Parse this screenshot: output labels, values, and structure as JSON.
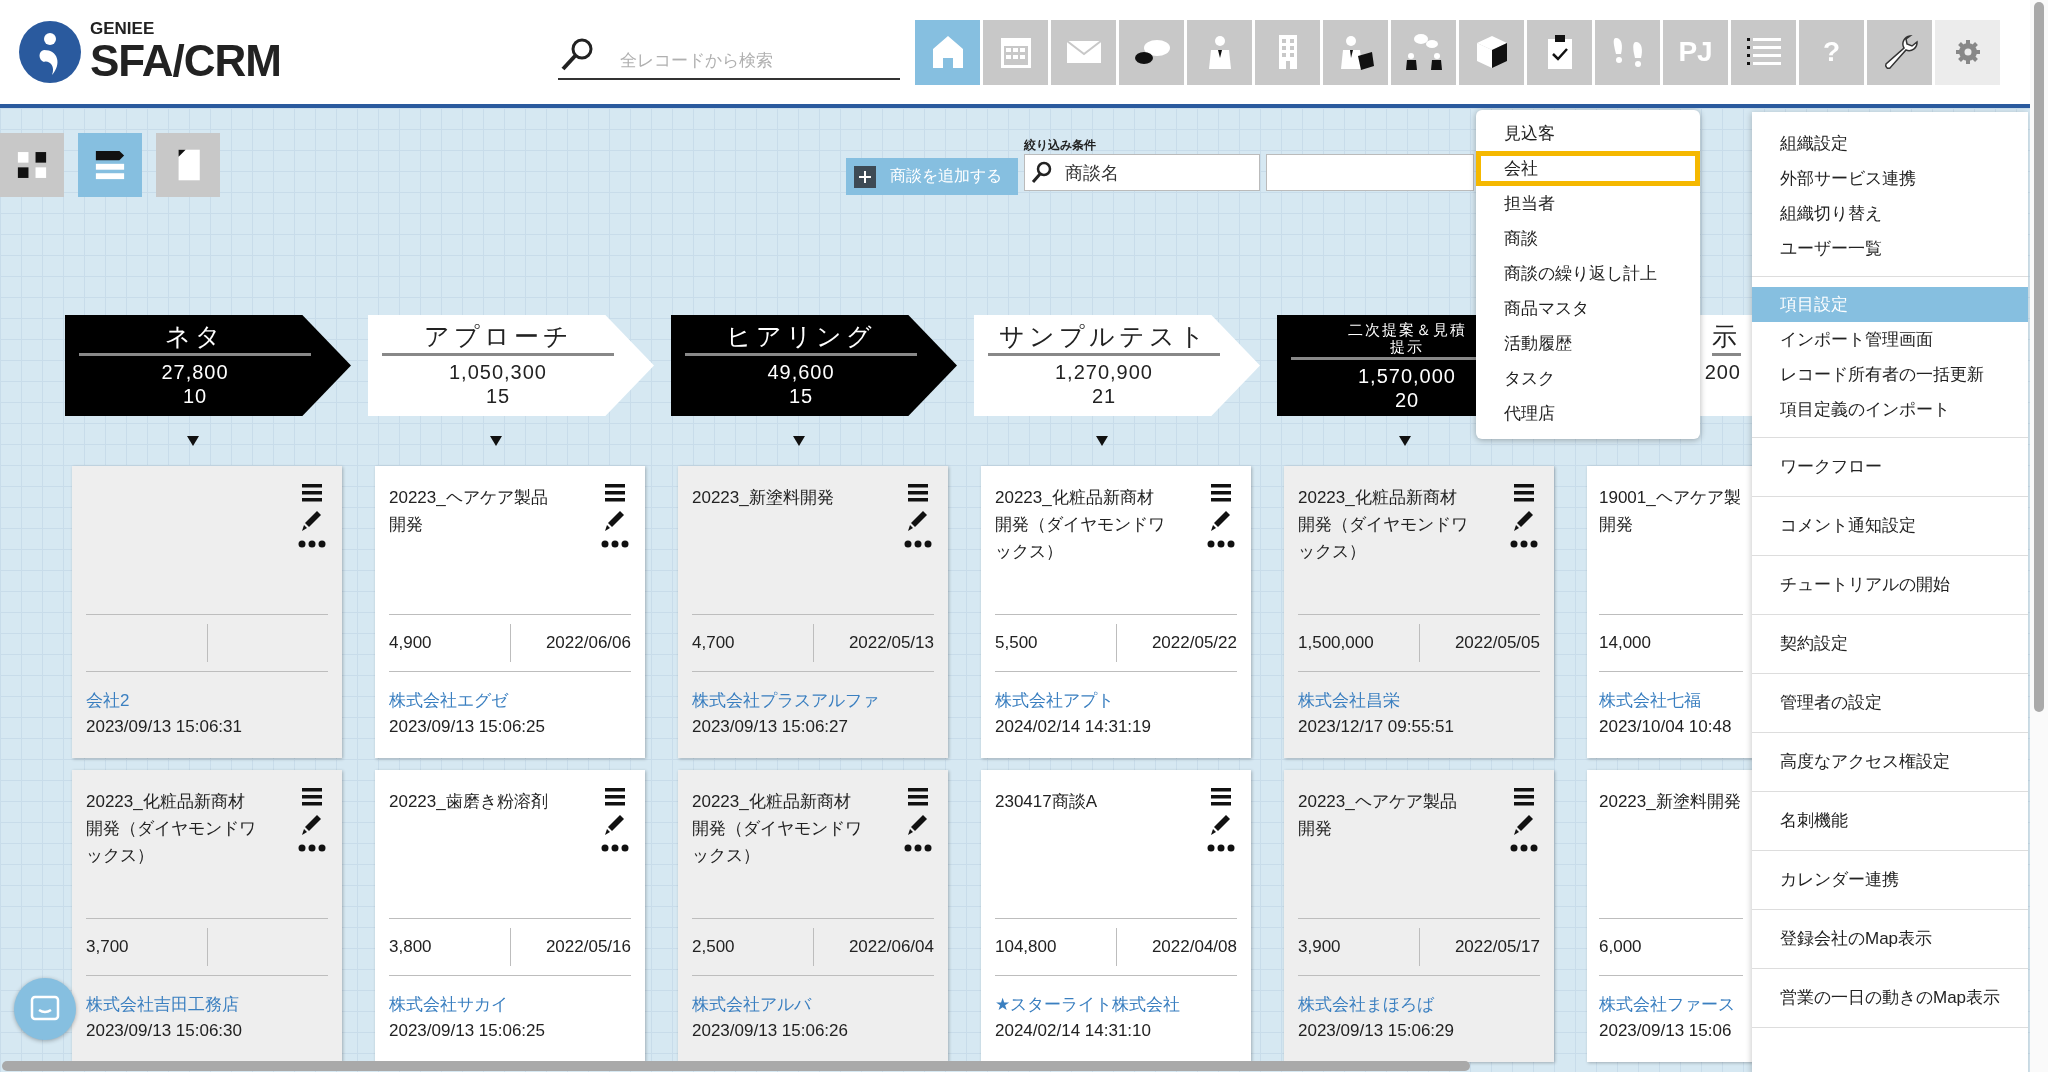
{
  "header": {
    "logo_small": "GENIEE",
    "logo_large": "SFA/CRM",
    "search": {
      "placeholder": "全レコードから検索"
    },
    "nav": [
      {
        "selected": true,
        "open": false
      },
      {
        "selected": false,
        "open": false
      },
      {
        "selected": false,
        "open": false
      },
      {
        "selected": false,
        "open": false
      },
      {
        "selected": false,
        "open": false
      },
      {
        "selected": false,
        "open": false
      },
      {
        "selected": false,
        "open": false
      },
      {
        "selected": false,
        "open": false
      },
      {
        "selected": false,
        "open": false
      },
      {
        "selected": false,
        "open": false
      },
      {
        "selected": false,
        "open": false
      },
      {
        "selected": false,
        "open": false,
        "label": "PJ"
      },
      {
        "selected": false,
        "open": false
      },
      {
        "selected": false,
        "open": false,
        "label": "?"
      },
      {
        "selected": false,
        "open": false
      },
      {
        "selected": false,
        "open": true
      }
    ]
  },
  "views": [
    {
      "selected": false
    },
    {
      "selected": true
    },
    {
      "selected": false
    }
  ],
  "add_button": {
    "label": "商談を追加する"
  },
  "filter": {
    "label": "絞り込み条件",
    "field": {
      "value": "商談名"
    }
  },
  "stages": [
    {
      "title": "ネタ",
      "amount": "27,800",
      "count": "10",
      "dark": true,
      "cards": [
        {
          "company": "会社2",
          "datetime": "2023/09/13 15:06:31"
        },
        {
          "title": "20223_化粧品新商材開発（ダイヤモンドワックス）",
          "amount": "3,700",
          "company": "株式会社吉田工務店",
          "datetime": "2023/09/13 15:06:30"
        }
      ]
    },
    {
      "title": "アプローチ",
      "amount": "1,050,300",
      "count": "15",
      "dark": false,
      "cards": [
        {
          "title": "20223_ヘアケア製品開発",
          "amount": "4,900",
          "date": "2022/06/06",
          "company": "株式会社エグゼ",
          "datetime": "2023/09/13 15:06:25"
        },
        {
          "title": "20223_歯磨き粉溶剤",
          "amount": "3,800",
          "date": "2022/05/16",
          "company": "株式会社サカイ",
          "datetime": "2023/09/13 15:06:25"
        }
      ]
    },
    {
      "title": "ヒアリング",
      "amount": "49,600",
      "count": "15",
      "dark": true,
      "cards": [
        {
          "title": "20223_新塗料開発",
          "amount": "4,700",
          "date": "2022/05/13",
          "company": "株式会社プラスアルファ",
          "datetime": "2023/09/13 15:06:27"
        },
        {
          "title": "20223_化粧品新商材開発（ダイヤモンドワックス）",
          "amount": "2,500",
          "date": "2022/06/04",
          "company": "株式会社アルバ",
          "datetime": "2023/09/13 15:06:26"
        }
      ]
    },
    {
      "title": "サンプルテスト",
      "amount": "1,270,900",
      "count": "21",
      "dark": false,
      "cards": [
        {
          "title": "20223_化粧品新商材開発（ダイヤモンドワックス）",
          "amount": "5,500",
          "date": "2022/05/22",
          "company": "株式会社アプト",
          "datetime": "2024/02/14 14:31:19"
        },
        {
          "title": "230417商談A",
          "amount": "104,800",
          "date": "2022/04/08",
          "company": "★スターライト株式会社",
          "datetime": "2024/02/14 14:31:10"
        }
      ]
    },
    {
      "title": "二次提案＆見積提示",
      "amount": "1,570,000",
      "count": "20",
      "dark": true,
      "cards": [
        {
          "title": "20223_化粧品新商材開発（ダイヤモンドワックス）",
          "amount": "1,500,000",
          "date": "2022/05/05",
          "company": "株式会社昌栄",
          "datetime": "2023/12/17 09:55:51"
        },
        {
          "title": "20223_ヘアケア製品開発",
          "amount": "3,900",
          "date": "2022/05/17",
          "company": "株式会社まほろば",
          "datetime": "2023/09/13 15:06:29"
        }
      ]
    },
    {
      "title": "示",
      "amount": "200",
      "dark": false,
      "cards": [
        {
          "title": "19001_ヘアケア製開発",
          "amount": "14,000",
          "company": "株式会社七福",
          "datetime": "2023/10/04 10:48"
        },
        {
          "title": "20223_新塗料開発",
          "amount": "6,000",
          "company": "株式会社ファース",
          "datetime": "2023/09/13 15:06"
        }
      ]
    }
  ],
  "record_menu": {
    "items": [
      {
        "label": "見込客",
        "selected": false
      },
      {
        "label": "会社",
        "selected": true
      },
      {
        "label": "担当者",
        "selected": false
      },
      {
        "label": "商談",
        "selected": false
      },
      {
        "label": "商談の繰り返し計上",
        "selected": false
      },
      {
        "label": "商品マスタ",
        "selected": false
      },
      {
        "label": "活動履歴",
        "selected": false
      },
      {
        "label": "タスク",
        "selected": false
      },
      {
        "label": "代理店",
        "selected": false
      }
    ]
  },
  "settings_menu": {
    "groups": [
      {
        "items": [
          {
            "label": "組織設定",
            "selected": false
          },
          {
            "label": "外部サービス連携",
            "selected": false
          },
          {
            "label": "組織切り替え",
            "selected": false
          },
          {
            "label": "ユーザー一覧",
            "selected": false
          }
        ]
      },
      {
        "items": [
          {
            "label": "項目設定",
            "selected": true
          },
          {
            "label": "インポート管理画面",
            "selected": false
          },
          {
            "label": "レコード所有者の一括更新",
            "selected": false
          },
          {
            "label": "項目定義のインポート",
            "selected": false
          }
        ]
      },
      {
        "items": [
          {
            "label": "ワークフロー",
            "selected": false
          }
        ]
      },
      {
        "items": [
          {
            "label": "コメント通知設定",
            "selected": false
          }
        ]
      },
      {
        "items": [
          {
            "label": "チュートリアルの開始",
            "selected": false
          }
        ]
      },
      {
        "items": [
          {
            "label": "契約設定",
            "selected": false
          }
        ]
      },
      {
        "items": [
          {
            "label": "管理者の設定",
            "selected": false
          }
        ]
      },
      {
        "items": [
          {
            "label": "高度なアクセス権設定",
            "selected": false
          }
        ]
      },
      {
        "items": [
          {
            "label": "名刺機能",
            "selected": false
          }
        ]
      },
      {
        "items": [
          {
            "label": "カレンダー連携",
            "selected": false
          }
        ]
      },
      {
        "items": [
          {
            "label": "登録会社のMap表示",
            "selected": false
          }
        ]
      },
      {
        "items": [
          {
            "label": "営業の一日の動きのMap表示",
            "selected": false
          }
        ]
      }
    ]
  }
}
